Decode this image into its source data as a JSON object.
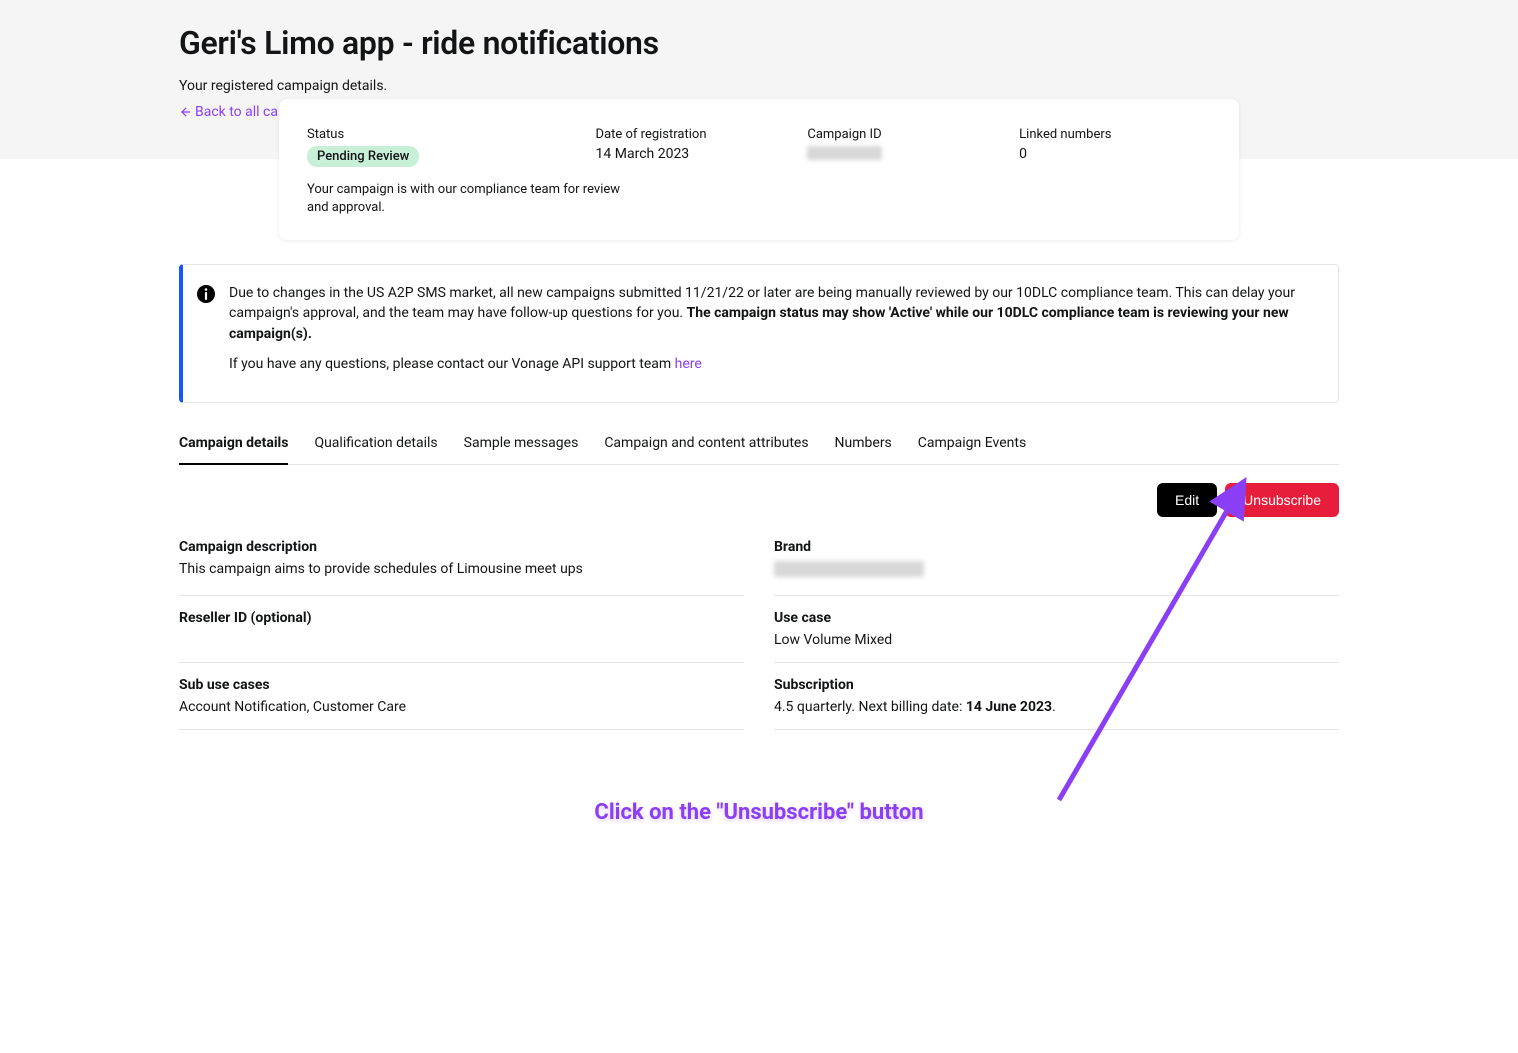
{
  "header": {
    "title": "Geri's Limo app - ride notifications",
    "subtitle": "Your registered campaign details.",
    "back_link": "Back to all campaigns"
  },
  "summary": {
    "status_label": "Status",
    "status_value": "Pending Review",
    "date_label": "Date of registration",
    "date_value": "14 March 2023",
    "campaign_id_label": "Campaign ID",
    "linked_label": "Linked numbers",
    "linked_value": "0",
    "description": "Your campaign is with our compliance team for review and approval."
  },
  "banner": {
    "p1_a": "Due to changes in the US A2P SMS market, all new campaigns submitted 11/21/22 or later are being manually reviewed by our 10DLC compliance team. This can delay your campaign's approval, and the team may have follow-up questions for you. ",
    "p1_b": "The campaign status may show 'Active' while our 10DLC compliance team is reviewing your new campaign(s).",
    "p2": "If you have any questions, please contact our Vonage API support team ",
    "link": "here"
  },
  "tabs": [
    "Campaign details",
    "Qualification details",
    "Sample messages",
    "Campaign and content attributes",
    "Numbers",
    "Campaign Events"
  ],
  "actions": {
    "edit": "Edit",
    "unsubscribe": "Unsubscribe"
  },
  "details": {
    "campaign_desc_label": "Campaign description",
    "campaign_desc_value": "This campaign aims to provide schedules of Limousine meet ups",
    "brand_label": "Brand",
    "reseller_label": "Reseller ID (optional)",
    "reseller_value": "",
    "usecase_label": "Use case",
    "usecase_value": "Low Volume Mixed",
    "subuse_label": "Sub use cases",
    "subuse_value": "Account Notification, Customer Care",
    "subscription_label": "Subscription",
    "subscription_prefix": "4.5 quarterly. Next billing date: ",
    "subscription_date": "14 June 2023",
    "subscription_suffix": "."
  },
  "annotation": "Click on the \"Unsubscribe\" button"
}
